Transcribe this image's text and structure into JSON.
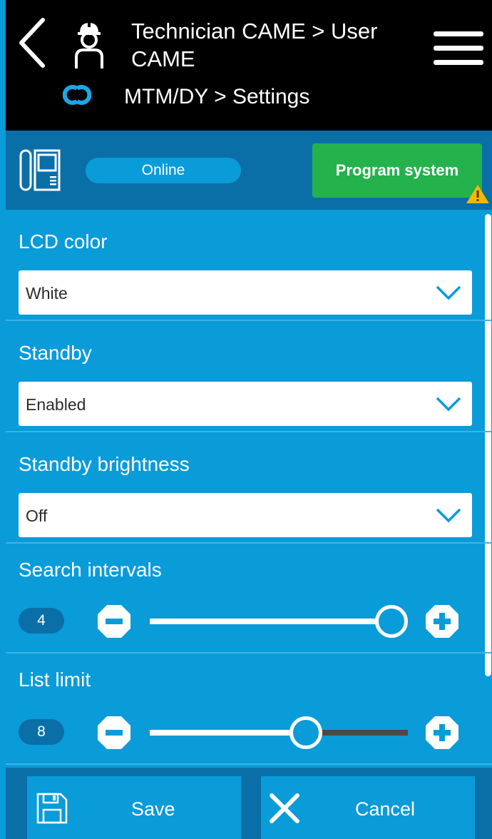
{
  "header": {
    "title": "Technician CAME > User CAME",
    "breadcrumb": "MTM/DY > Settings"
  },
  "status": {
    "connection": "Online",
    "program_button": "Program system"
  },
  "settings": {
    "lcd_color": {
      "label": "LCD color",
      "value": "White"
    },
    "standby": {
      "label": "Standby",
      "value": "Enabled"
    },
    "standby_brightness": {
      "label": "Standby brightness",
      "value": "Off"
    },
    "search_intervals": {
      "label": "Search intervals",
      "value": "4",
      "level": 1.0
    },
    "list_limit": {
      "label": "List limit",
      "value": "8",
      "level": 0.62
    }
  },
  "footer": {
    "save_label": "Save",
    "cancel_label": "Cancel"
  },
  "colors": {
    "primary": "#0a9bd9",
    "dark_primary": "#0a6fa7",
    "header_bg": "#000000",
    "program_green": "#24b24d",
    "warning": "#f5b800"
  },
  "icons": [
    "back-icon",
    "technician-icon",
    "menu-icon",
    "link-icon",
    "intercom-device-icon",
    "warning-icon",
    "chevron-down-icon",
    "minus-icon",
    "plus-icon",
    "save-icon",
    "cancel-icon"
  ]
}
